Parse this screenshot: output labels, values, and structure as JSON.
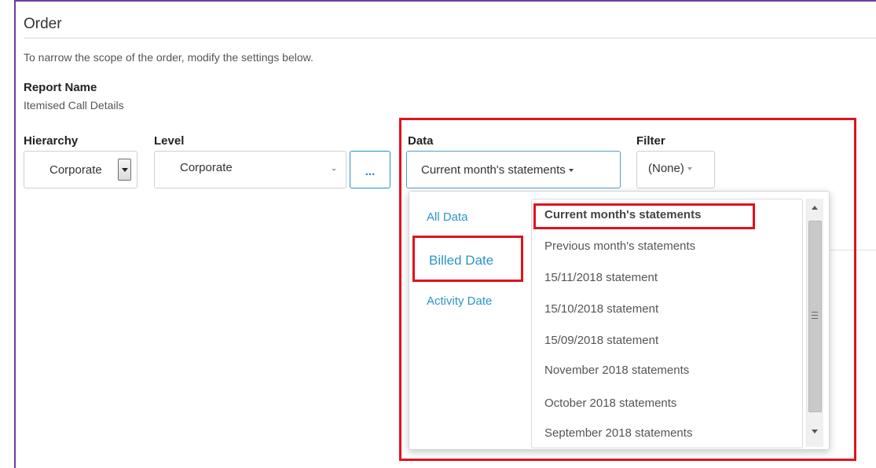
{
  "section": {
    "title": "Order",
    "intro": "To narrow the scope of the order, modify the settings below."
  },
  "report": {
    "label": "Report Name",
    "value": "Itemised Call Details"
  },
  "hierarchy": {
    "label": "Hierarchy",
    "value": "Corporate"
  },
  "level": {
    "label": "Level",
    "value": "Corporate",
    "more_button": "..."
  },
  "data": {
    "label": "Data",
    "value": "Current month's statements"
  },
  "filter": {
    "label": "Filter",
    "value": "(None)"
  },
  "dropdown": {
    "tabs": [
      "All Data",
      "Billed Date",
      "Activity Date"
    ],
    "active_tab": "Billed Date",
    "options": [
      "Current month's statements",
      "Previous month's statements",
      "15/11/2018 statement",
      "15/10/2018 statement",
      "15/09/2018 statement",
      "November 2018 statements",
      "October 2018 statements",
      "September 2018 statements"
    ],
    "selected_option": "Current month's statements"
  },
  "colors": {
    "highlight": "#e0131f",
    "link": "#2b95c8",
    "frame": "#6b3fa0"
  }
}
